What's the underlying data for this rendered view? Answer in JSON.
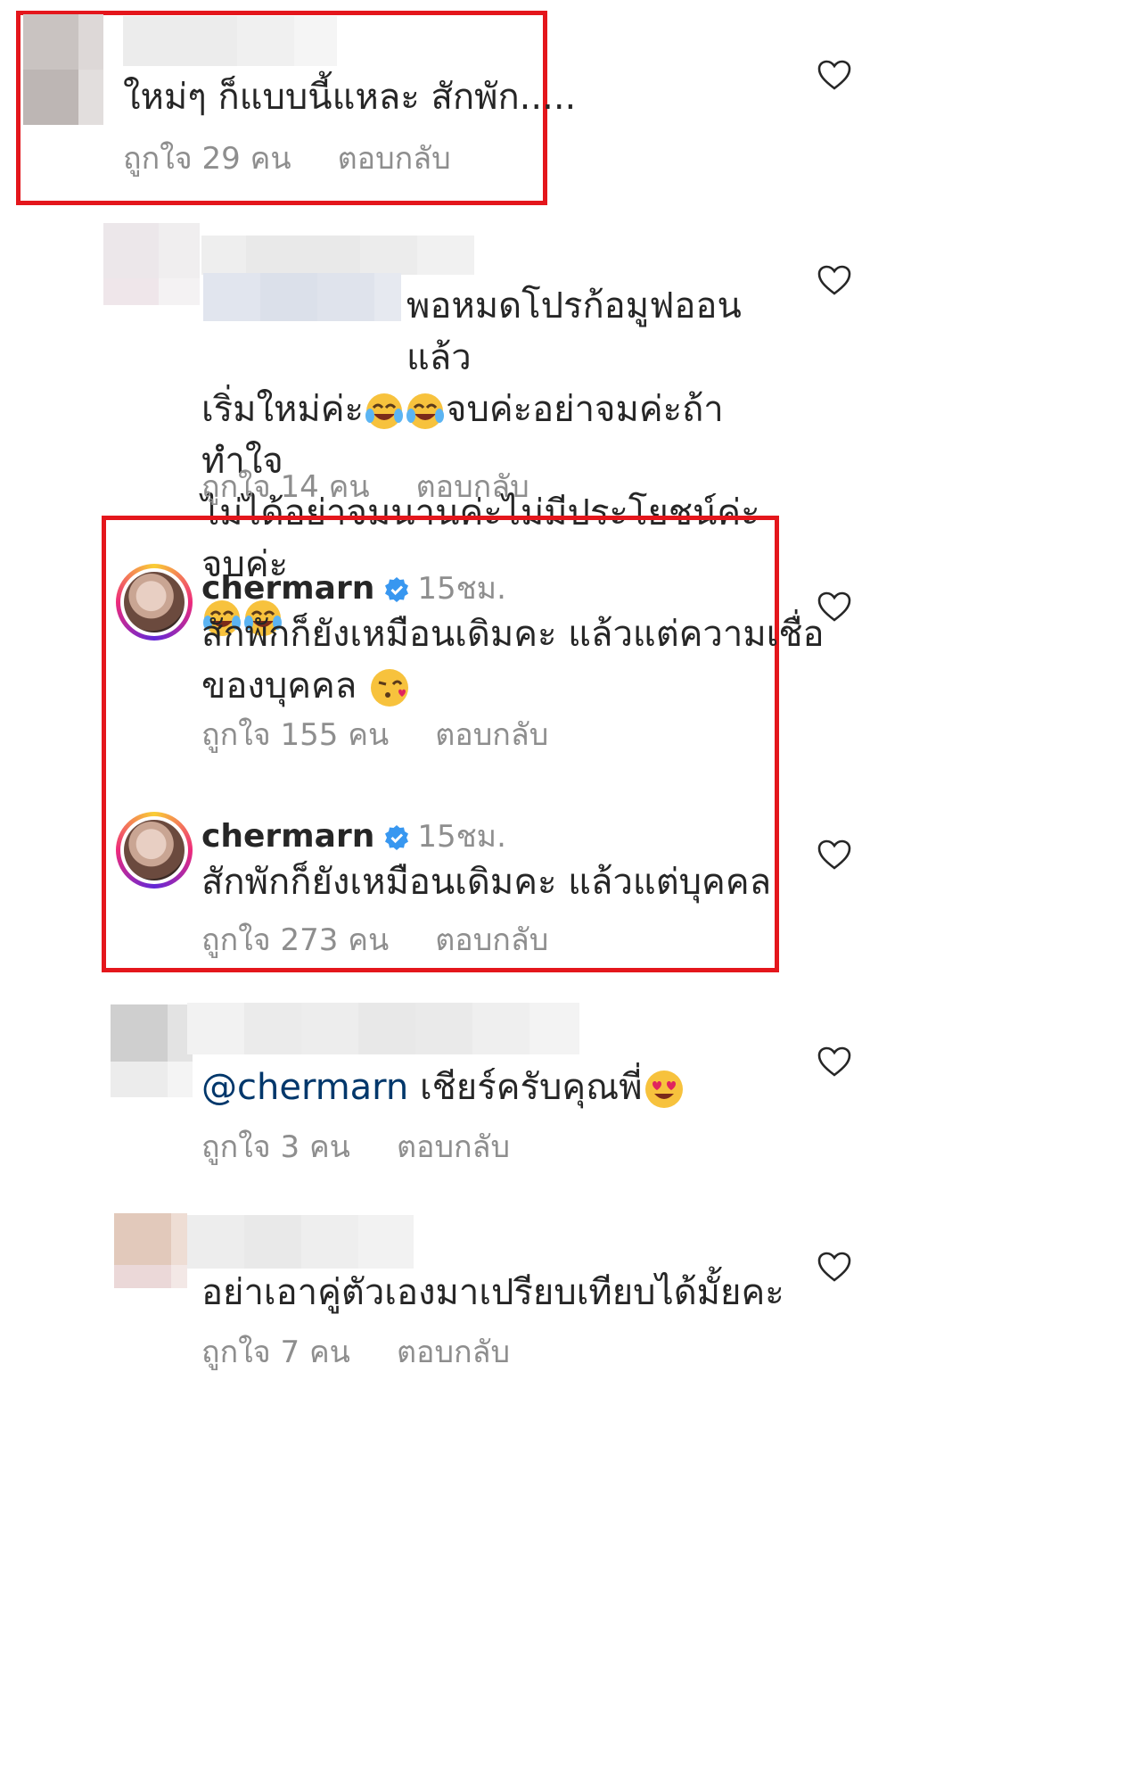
{
  "comments": [
    {
      "username": "",
      "text_lines": [
        "ใหม่ๆ ก็แบบนี้แหละ สักพัก....."
      ],
      "likes": "ถูกใจ 29 คน",
      "reply": "ตอบกลับ"
    },
    {
      "username": "",
      "text_lines": [
        "พอหมดโปรก้อมูฟออนแล้ว",
        "เริ่มใหม่ค่ะ",
        "จบค่ะอย่าจมค่ะถ้าทำใจ",
        "ไม่ได้อย่าจมนานค่ะไม่มีประโยชน์ค่ะจบค่ะ"
      ],
      "likes": "ถูกใจ 14 คน",
      "reply": "ตอบกลับ"
    },
    {
      "username": "chermarn",
      "time": "15ชม.",
      "text_lines": [
        "สักพักก็ยังเหมือนเดิมคะ แล้วแต่ความเชื่อ",
        "ของบุคคล"
      ],
      "likes": "ถูกใจ 155 คน",
      "reply": "ตอบกลับ"
    },
    {
      "username": "chermarn",
      "time": "15ชม.",
      "text_lines": [
        "สักพักก็ยังเหมือนเดิมคะ แล้วแต่บุคคล"
      ],
      "likes": "ถูกใจ 273 คน",
      "reply": "ตอบกลับ"
    },
    {
      "username": "",
      "mention": "@chermarn",
      "text_lines": [
        "เชียร์ครับคุณพี่"
      ],
      "likes": "ถูกใจ 3 คน",
      "reply": "ตอบกลับ"
    },
    {
      "username": "",
      "text_lines": [
        "อย่าเอาคู่ตัวเองมาเปรียบเทียบได้มั้ยคะ"
      ],
      "likes": "ถูกใจ 7 คน",
      "reply": "ตอบกลับ"
    }
  ],
  "colors": {
    "highlight": "#e4161c",
    "muted": "#8e8e8e",
    "verified": "#3897f0",
    "mention": "#00376b"
  }
}
